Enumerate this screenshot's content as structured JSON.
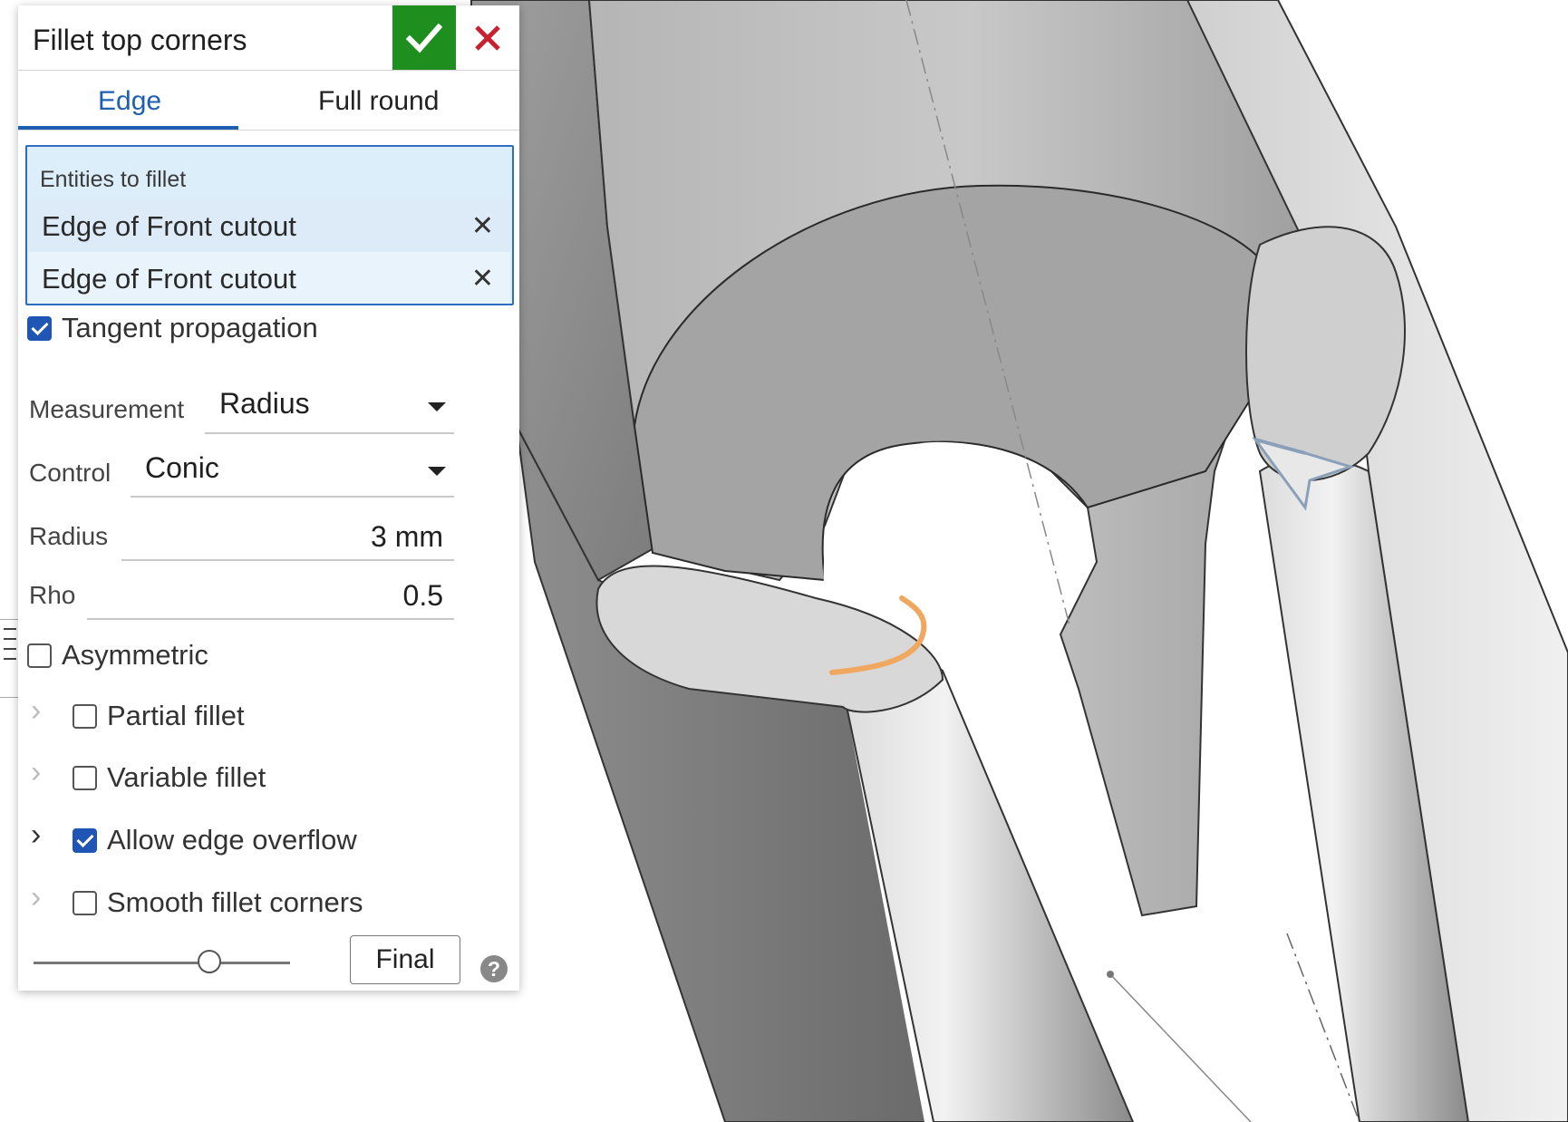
{
  "dialog": {
    "title": "Fillet top corners",
    "confirm_icon": "checkmark-icon",
    "cancel_icon": "close-icon",
    "colors": {
      "confirm": "#1e8f1e",
      "cancel": "#c8202e",
      "accent": "#1f5fb0"
    }
  },
  "tabs": [
    {
      "label": "Edge",
      "active": true
    },
    {
      "label": "Full round",
      "active": false
    }
  ],
  "entities": {
    "label": "Entities to fillet",
    "items": [
      "Edge of Front cutout",
      "Edge of Front cutout"
    ],
    "remove_icon": "close-icon"
  },
  "tangent_propagation": {
    "label": "Tangent propagation",
    "checked": true
  },
  "measurement": {
    "label": "Measurement",
    "value": "Radius"
  },
  "control": {
    "label": "Control",
    "value": "Conic"
  },
  "radius": {
    "label": "Radius",
    "value": "3 mm"
  },
  "rho": {
    "label": "Rho",
    "value": "0.5"
  },
  "asymmetric": {
    "label": "Asymmetric",
    "checked": false
  },
  "options": [
    {
      "label": "Partial fillet",
      "checked": false
    },
    {
      "label": "Variable fillet",
      "checked": false
    },
    {
      "label": "Allow edge overflow",
      "checked": true
    },
    {
      "label": "Smooth fillet corners",
      "checked": false
    }
  ],
  "footer": {
    "final_label": "Final",
    "help_label": "?",
    "slider_level": 0.62
  }
}
